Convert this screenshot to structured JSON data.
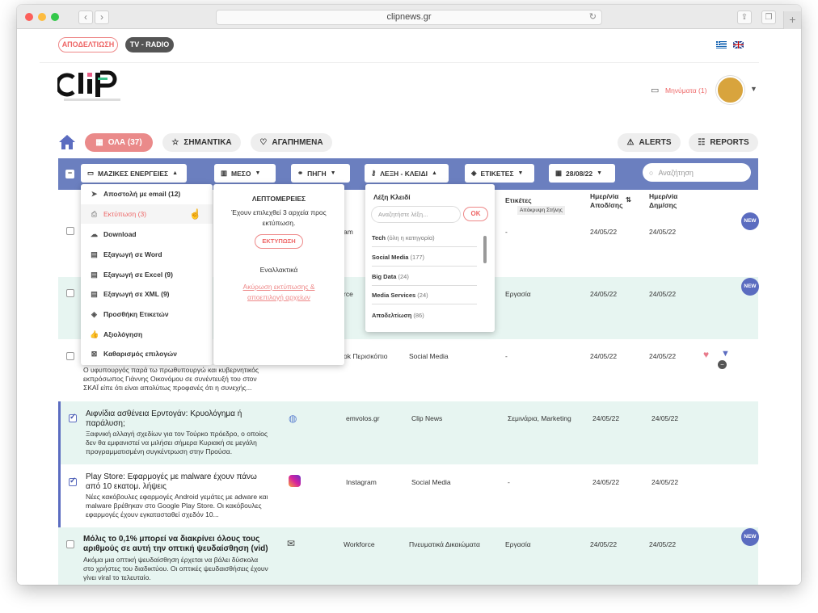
{
  "browser": {
    "url": "clipnews.gr"
  },
  "topnav": {
    "apodeltiosi": "ΑΠΟΔΕΛΤΙΩΣΗ",
    "tvradio": "TV - RADIO"
  },
  "header": {
    "messages": "Μηνύματα (1)"
  },
  "tabs": {
    "all": "ΟΛΑ (37)",
    "important": "ΣΗΜΑΝΤΙΚΑ",
    "favorites": "ΑΓΑΠΗΜΕΝΑ",
    "alerts": "ALERTS",
    "reports": "REPORTS"
  },
  "filters": {
    "mass": "ΜΑΖΙΚΕΣ ΕΝΕΡΓΕΙΕΣ",
    "medium": "ΜΕΣΟ",
    "source": "ΠΗΓΗ",
    "keyword": "ΛΕΞΗ - ΚΛΕΙΔΙ",
    "labels": "ΕΤΙΚΕΤΕΣ",
    "date": "28/08/22",
    "search_placeholder": "Αναζήτηση"
  },
  "table_header": {
    "labels": "Ετικέτες",
    "hide_col": "Απόκρυψη Στήλης",
    "pub_date": "Ημερ/νία Αποδ/σης",
    "create_date": "Ημερ/νία Δημ/σης"
  },
  "mass_menu": [
    {
      "label": "Αποστολή με email (12)",
      "icon": "send-icon"
    },
    {
      "label": "Εκτύπωση (3)",
      "icon": "print-icon"
    },
    {
      "label": "Download",
      "icon": "download-icon"
    },
    {
      "label": "Εξαγωγή σε Word",
      "icon": "word-icon"
    },
    {
      "label": "Εξαγωγή σε Excel (9)",
      "icon": "excel-icon"
    },
    {
      "label": "Εξαγωγή σε XML (9)",
      "icon": "xml-icon"
    },
    {
      "label": "Προσθήκη Ετικετών",
      "icon": "tag-icon"
    },
    {
      "label": "Αξιολόγηση",
      "icon": "thumbs-up-icon"
    },
    {
      "label": "Καθαρισμός επιλογών",
      "icon": "clear-icon"
    }
  ],
  "details": {
    "title": "ΛΕΠΤΟΜΕΡΕΙΕΣ",
    "text": "Έχουν επιλεχθεί 3 αρχεία προς εκτύπωση.",
    "print_btn": "ΕΚΤΥΠΩΣΗ",
    "alt": "Εναλλακτικά",
    "cancel": "Ακύρωση εκτύπωσης & αποεπιλογή αρχείων"
  },
  "keywords": {
    "title": "Λέξη Κλειδί",
    "placeholder": "Αναζητήστε λέξη...",
    "ok": "OK",
    "items": [
      {
        "name": "Tech",
        "count": "(όλη η κατηγορία)"
      },
      {
        "name": "Social Media",
        "count": "(177)"
      },
      {
        "name": "Big Data",
        "count": "(24)"
      },
      {
        "name": "Media Services",
        "count": "(24)"
      },
      {
        "name": "Αποδελτίωση",
        "count": "(86)"
      }
    ]
  },
  "rows": [
    {
      "source": "am",
      "category": "",
      "labels": "-",
      "d1": "24/05/22",
      "d2": "24/05/22",
      "new": "NEW"
    },
    {
      "source": "rce",
      "category": "",
      "labels": "Εργασία",
      "d1": "24/05/22",
      "d2": "24/05/22",
      "new": "NEW"
    },
    {
      "summary": "Ο υφυπουργός παρά τω πρωθυπουργώ και κυβερνητικός εκπρόσωπος Γιάννης Οικονόμου σε συνέντευξή του στον ΣΚΑΪ είπε ότι είναι απολύτως προφανές ότι η συνεχής...",
      "source": "ok Περισκόπιο",
      "category": "Social Media",
      "labels": "-",
      "d1": "24/05/22",
      "d2": "24/05/22"
    },
    {
      "title": "Αιφνίδια ασθένεια Ερντογάν: Κρυολόγημα ή παράλυση;",
      "summary": "Ξαφνική αλλαγή σχεδίων για τον Τούρκο πρόεδρο, ο οποίος δεν θα εμφανιστεί να μιλήσει σήμερα Κυριακή σε μεγάλη προγραμματισμένη συγκέντρωση στην Προύσα.",
      "source": "emvolos.gr",
      "category": "Clip News",
      "labels": "Σεμινάρια, Marketing",
      "d1": "24/05/22",
      "d2": "24/05/22"
    },
    {
      "title": "Play Store: Εφαρμογές με malware έχουν πάνω από 10 εκατομ. λήψεις",
      "summary": "Νέες κακόβουλες εφαρμογές Android γεμάτες με adware και malware βρέθηκαν στο Google Play Store. Οι κακόβουλες εφαρμογές έχουν εγκατασταθεί σχεδόν 10...",
      "source": "Instagram",
      "category": "Social Media",
      "labels": "-",
      "d1": "24/05/22",
      "d2": "24/05/22"
    },
    {
      "title": "Μόλις το 0,1% μπορεί να διακρίνει όλους τους αριθμούς σε αυτή την οπτική ψευδαίσθηση (vid)",
      "summary": "Ακόμα μια οπτική ψευδαίσθηση έρχεται να βάλει δύσκολα στο χρήστες του διαδικτύου. Οι οπτικές ψευδαισθήσεις έχουν γίνει viral το τελευταίο.",
      "source": "Workforce",
      "category": "Πνευματικά Δικαιώματα",
      "labels": "Εργασία",
      "d1": "24/05/22",
      "d2": "24/05/22",
      "new": "NEW"
    }
  ]
}
